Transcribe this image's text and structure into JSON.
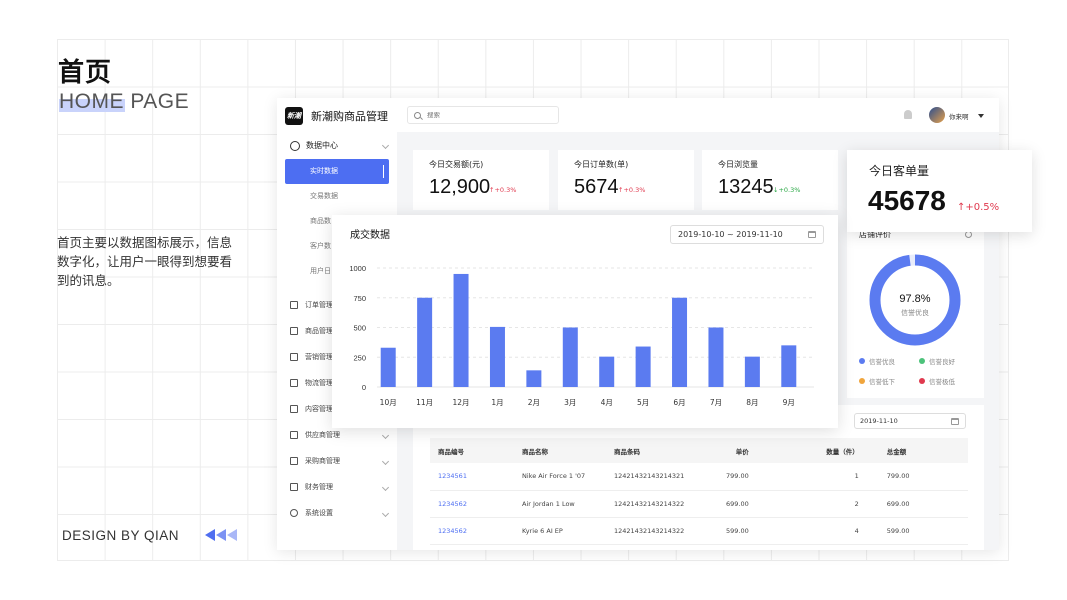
{
  "page": {
    "title": "首页",
    "subtitle": "HOME PAGE",
    "description": "首页主要以数据图标展示，信息数字化，让用户一眼得到想要看到的讯息。",
    "design_by": "DESIGN BY QIAN"
  },
  "app": {
    "brand_logo": "新潮",
    "brand_name": "新潮购商品管理",
    "search_placeholder": "搜索",
    "user_name": "你来啊",
    "sidebar": {
      "group_label": "数据中心",
      "sub_items": [
        "实时数据",
        "交易数据",
        "商品数",
        "客户数",
        "用户日"
      ],
      "active_index": 0,
      "nav_items": [
        "订单管理",
        "商品管理",
        "营销管理",
        "物流管理",
        "内容管理",
        "供应商管理",
        "采购商管理",
        "财务管理",
        "系统设置"
      ]
    },
    "stats": [
      {
        "label": "今日交易额(元)",
        "value": "12,900",
        "change": "+0.3%",
        "direction": "up"
      },
      {
        "label": "今日订单数(单)",
        "value": "5674",
        "change": "+0.3%",
        "direction": "up"
      },
      {
        "label": "今日浏览量",
        "value": "13245",
        "change": "+0.3%",
        "direction": "down"
      }
    ],
    "float_kpi": {
      "label": "今日客单量",
      "value": "45678",
      "change": "+0.5%",
      "direction": "up"
    },
    "store_rating": {
      "title": "店铺评价",
      "percent": 97.8,
      "percent_label": "97.8%",
      "center_label": "信誉优良",
      "legend": [
        {
          "label": "信誉优良",
          "color": "#5b7bf0"
        },
        {
          "label": "信誉良好",
          "color": "#4cc27a"
        },
        {
          "label": "信誉低下",
          "color": "#f0a53c"
        },
        {
          "label": "信誉极低",
          "color": "#e0394e"
        }
      ]
    },
    "table": {
      "date": "2019-11-10",
      "columns": [
        "商品编号",
        "商品名称",
        "商品条码",
        "单价",
        "数量（件）",
        "总金额"
      ],
      "rows": [
        [
          "1234561",
          "Nike Air Force 1 '07",
          "12421432143214321",
          "799.00",
          "1",
          "799.00"
        ],
        [
          "1234562",
          "Air Jordan 1 Low",
          "12421432143214322",
          "699.00",
          "2",
          "699.00"
        ],
        [
          "1234562",
          "Kyrie 6 AI EP",
          "12421432143214322",
          "599.00",
          "4",
          "599.00"
        ]
      ]
    }
  },
  "chart_data": {
    "type": "bar",
    "title": "成交数据",
    "date_range": "2019-10-10 ~ 2019-11-10",
    "categories": [
      "10月",
      "11月",
      "12月",
      "1月",
      "2月",
      "3月",
      "4月",
      "5月",
      "6月",
      "7月",
      "8月",
      "9月"
    ],
    "values": [
      330,
      750,
      950,
      505,
      140,
      500,
      255,
      340,
      750,
      500,
      255,
      350
    ],
    "ylim": [
      0,
      1000
    ],
    "yticks": [
      0,
      250,
      500,
      750,
      1000
    ],
    "grid": true,
    "color": "#5b7bf0"
  }
}
